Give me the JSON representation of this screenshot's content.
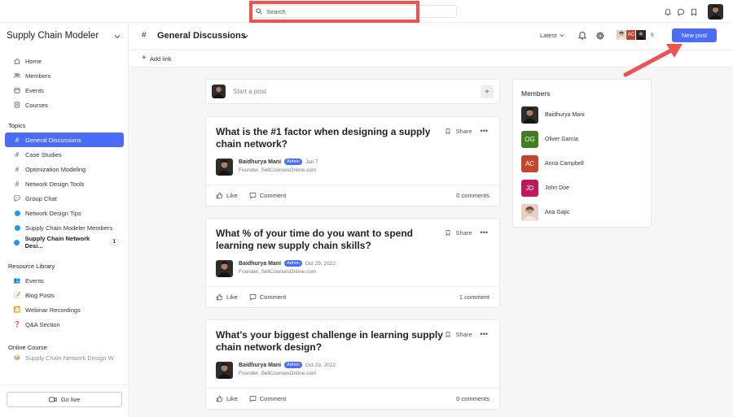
{
  "topbar": {
    "search_placeholder": "Search",
    "icons": [
      "bell-icon",
      "chat-icon",
      "bookmark-icon"
    ]
  },
  "sidebar": {
    "brand": "Supply Chain Modeler",
    "top_items": [
      {
        "label": "Home",
        "icon": "home-icon"
      },
      {
        "label": "Members",
        "icon": "members-icon"
      },
      {
        "label": "Events",
        "icon": "calendar-icon"
      },
      {
        "label": "Courses",
        "icon": "courses-icon"
      }
    ],
    "topics_label": "Topics",
    "topics": [
      {
        "label": "General Discussions",
        "icon": "#"
      },
      {
        "label": "Case Studies",
        "icon": "#"
      },
      {
        "label": "Optimization Modeling",
        "icon": "#"
      },
      {
        "label": "Network Design Tools",
        "icon": "#"
      },
      {
        "label": "Group Chat",
        "icon": "💬"
      },
      {
        "label": "Network Design Tips",
        "icon": "dot"
      },
      {
        "label": "Supply Chain Modeler Members",
        "icon": "dot"
      },
      {
        "label": "Supply Chain Network Desi...",
        "icon": "dot",
        "count": "1"
      }
    ],
    "resource_label": "Resource Library",
    "resources": [
      {
        "label": "Events",
        "icon": "👥"
      },
      {
        "label": "Blog Posts",
        "icon": "📝"
      },
      {
        "label": "Webinar Recordings",
        "icon": "🎦"
      },
      {
        "label": "Q&A Section",
        "icon": "❓"
      }
    ],
    "online_course_label": "Online Course",
    "online_course_item": "Supply Chain Network Design W",
    "go_live": "Go live"
  },
  "header": {
    "hash": "#",
    "title": "General Discussions",
    "sort": "Latest",
    "member_count": "5",
    "stack_initials": "AC",
    "new_post": "New post"
  },
  "subbar": {
    "add_link": "Add link"
  },
  "composer": {
    "placeholder": "Start a post"
  },
  "posts": [
    {
      "title": "What is the #1 factor when designing a supply chain network?",
      "author": "Baidhurya Mani",
      "badge": "Admin",
      "date": "Jan 7",
      "role": "Founder, SellCoursesOnline.com",
      "like": "Like",
      "comment": "Comment",
      "comments": "0 comments",
      "share": "Share"
    },
    {
      "title": "What % of your time do you want to spend learning new supply chain skills?",
      "author": "Baidhurya Mani",
      "badge": "Admin",
      "date": "Oct 29, 2022",
      "role": "Founder, SellCoursesOnline.com",
      "like": "Like",
      "comment": "Comment",
      "comments": "1 comment",
      "share": "Share"
    },
    {
      "title": "What's your biggest challenge in learning supply chain network design?",
      "author": "Baidhurya Mani",
      "badge": "Admin",
      "date": "Oct 29, 2022",
      "role": "Founder, SellCoursesOnline.com",
      "like": "Like",
      "comment": "Comment",
      "comments": "0 comments",
      "share": "Share"
    }
  ],
  "members": {
    "title": "Members",
    "list": [
      {
        "name": "Baidhurya Mani",
        "initials": "",
        "color": "#3a3a3a"
      },
      {
        "name": "Oliver Garcia",
        "initials": "OG",
        "color": "#3f7d20"
      },
      {
        "name": "Anna Campbell",
        "initials": "AC",
        "color": "#c0472b"
      },
      {
        "name": "John Doe",
        "initials": "JD",
        "color": "#c2185b"
      },
      {
        "name": "Ana Gajic",
        "initials": "",
        "color": "#d9b3a5"
      }
    ]
  },
  "colors": {
    "accent": "#4a6cf7",
    "highlight": "#ef5350"
  }
}
